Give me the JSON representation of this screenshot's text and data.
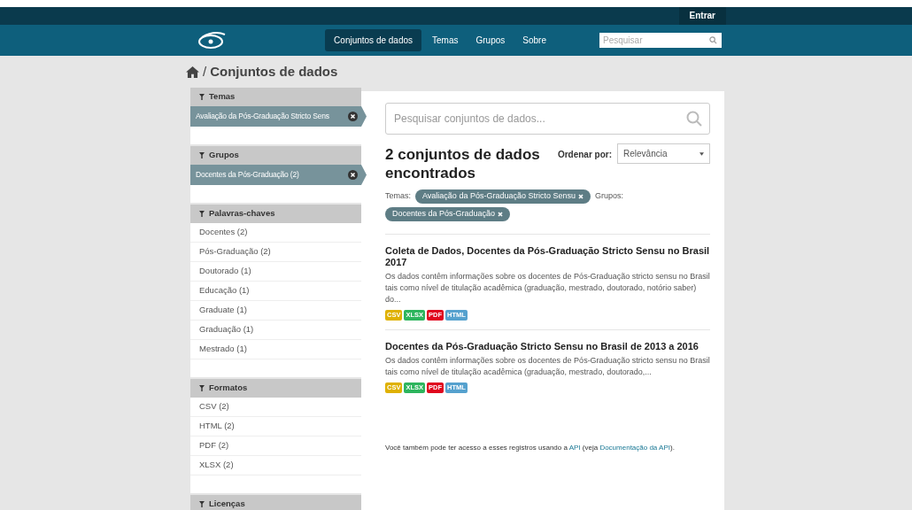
{
  "account_bar": {
    "login": "Entrar"
  },
  "nav": {
    "items": [
      {
        "label": "Conjuntos de dados",
        "selected": true
      },
      {
        "label": "Temas",
        "selected": false
      },
      {
        "label": "Grupos",
        "selected": false
      },
      {
        "label": "Sobre",
        "selected": false
      }
    ],
    "search": {
      "placeholder": "Pesquisar"
    }
  },
  "breadcrumb": {
    "separator": "/",
    "current": "Conjuntos de dados"
  },
  "facets": [
    {
      "title": "Temas",
      "items": [
        {
          "label": "Avaliação da Pós-Graduação Stricto Sens",
          "selected": true
        }
      ]
    },
    {
      "title": "Grupos",
      "items": [
        {
          "label": "Docentes da Pós-Graduação (2)",
          "selected": true
        }
      ]
    },
    {
      "title": "Palavras-chaves",
      "items": [
        {
          "label": "Docentes (2)",
          "selected": false
        },
        {
          "label": "Pós-Graduação (2)",
          "selected": false
        },
        {
          "label": "Doutorado (1)",
          "selected": false
        },
        {
          "label": "Educação (1)",
          "selected": false
        },
        {
          "label": "Graduate (1)",
          "selected": false
        },
        {
          "label": "Graduação (1)",
          "selected": false
        },
        {
          "label": "Mestrado (1)",
          "selected": false
        }
      ]
    },
    {
      "title": "Formatos",
      "items": [
        {
          "label": "CSV (2)",
          "selected": false
        },
        {
          "label": "HTML (2)",
          "selected": false
        },
        {
          "label": "PDF (2)",
          "selected": false
        },
        {
          "label": "XLSX (2)",
          "selected": false
        }
      ]
    },
    {
      "title": "Licenças"
    }
  ],
  "search": {
    "placeholder": "Pesquisar conjuntos de dados..."
  },
  "results_heading": "2 conjuntos de dados encontrados",
  "sort": {
    "label": "Ordenar por:",
    "value": "Relevância"
  },
  "active_filters": [
    {
      "kind": "label",
      "text": "Temas:"
    },
    {
      "kind": "pill",
      "text": "Avaliação da Pós-Graduação Stricto Sensu"
    },
    {
      "kind": "label",
      "text": "Grupos:"
    },
    {
      "kind": "pill",
      "text": "Docentes da Pós-Graduação"
    }
  ],
  "datasets": [
    {
      "title": "Coleta de Dados, Docentes da Pós-Graduação Stricto Sensu no Brasil 2017",
      "description": "Os dados contêm informações sobre os docentes de Pós-Graduação stricto sensu no Brasil tais como nível de titulação acadêmica (graduação, mestrado, doutorado, notório saber) do...",
      "formats": [
        {
          "label": "CSV",
          "color": "#dfb100"
        },
        {
          "label": "XLSX",
          "color": "#2db55d"
        },
        {
          "label": "PDF",
          "color": "#e0051e"
        },
        {
          "label": "HTML",
          "color": "#55a1ce"
        }
      ]
    },
    {
      "title": "Docentes da Pós-Graduação Stricto Sensu no Brasil de 2013 a 2016",
      "description": "Os dados contêm informações sobre os docentes de Pós-Graduação stricto sensu no Brasil tais como nível de titulação acadêmica (graduação, mestrado, doutorado,...",
      "formats": [
        {
          "label": "CSV",
          "color": "#dfb100"
        },
        {
          "label": "XLSX",
          "color": "#2db55d"
        },
        {
          "label": "PDF",
          "color": "#e0051e"
        },
        {
          "label": "HTML",
          "color": "#55a1ce"
        }
      ]
    }
  ],
  "api_note": [
    {
      "kind": "text",
      "text": "Você também pode ter acesso a esses registros usando a "
    },
    {
      "kind": "link",
      "text": "API"
    },
    {
      "kind": "text",
      "text": " (veja "
    },
    {
      "kind": "link",
      "text": "Documentação da API"
    },
    {
      "kind": "text",
      "text": ")."
    }
  ]
}
